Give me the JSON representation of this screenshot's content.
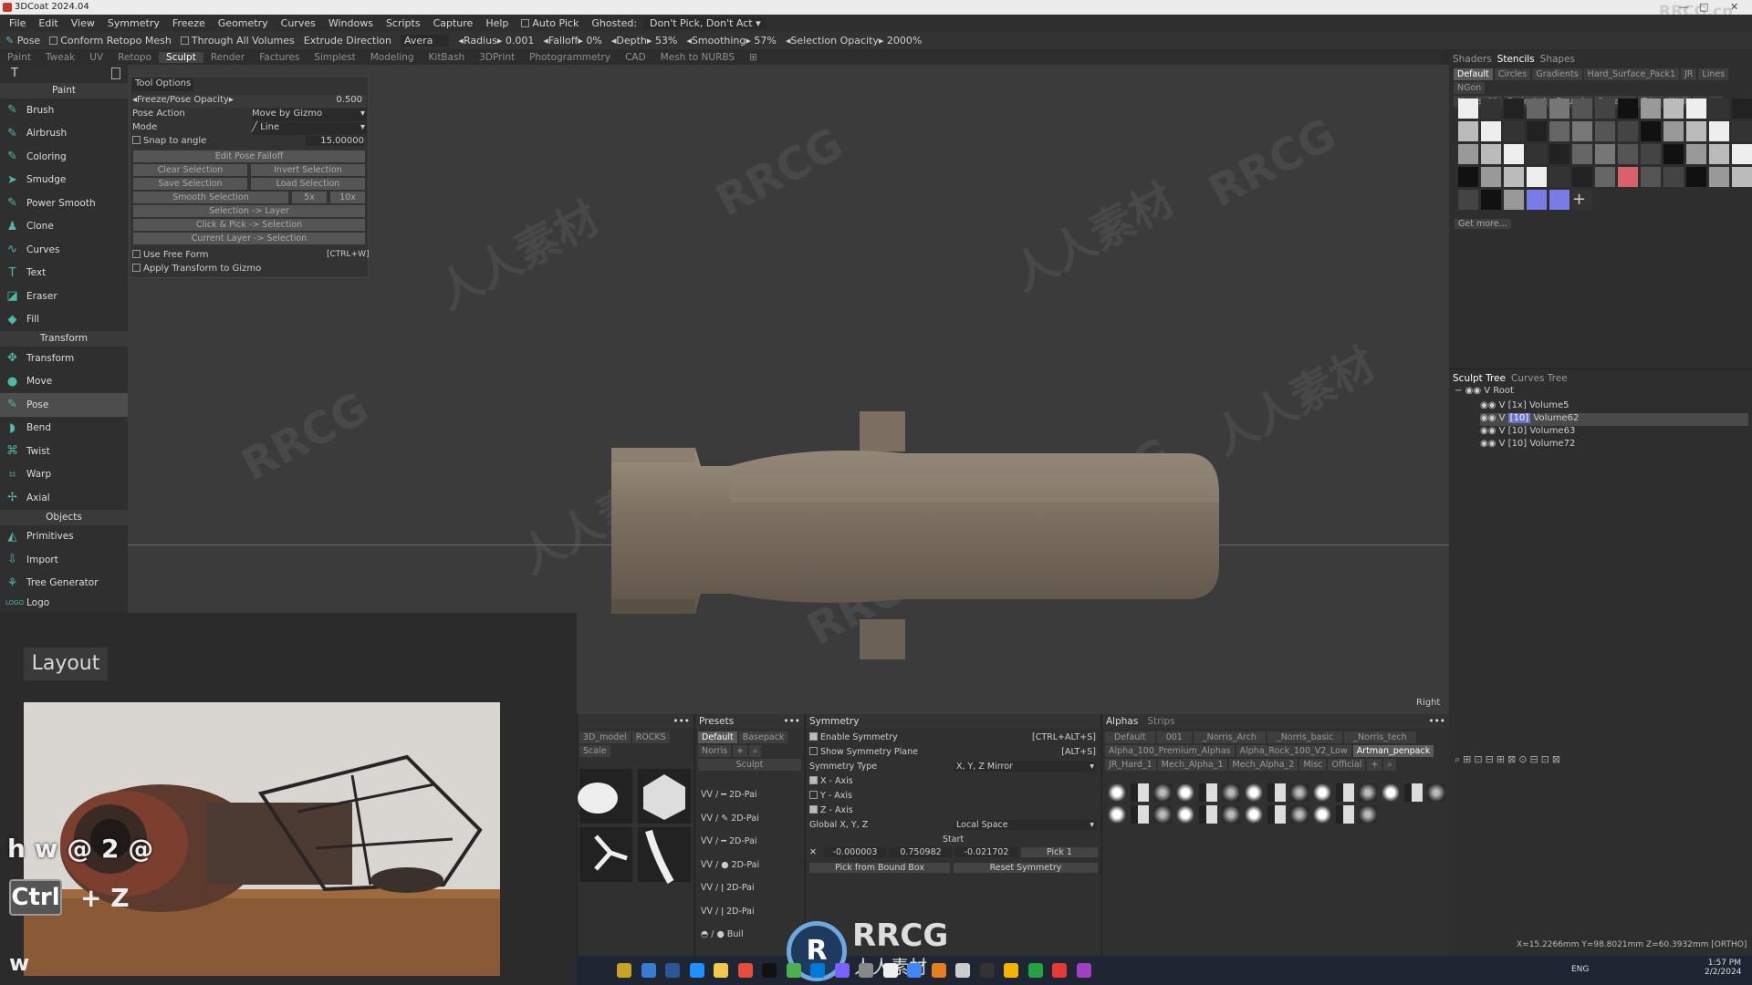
{
  "window": {
    "title": "3DCoat 2024.04",
    "watermark": "RRCG.cn"
  },
  "menu": [
    "File",
    "Edit",
    "View",
    "Symmetry",
    "Freeze",
    "Geometry",
    "Curves",
    "Windows",
    "Scripts",
    "Capture",
    "Help"
  ],
  "menu_extras": {
    "auto_pick": "Auto Pick",
    "ghosted_label": "Ghosted:",
    "ghosted_value": "Don't Pick, Don't Act"
  },
  "toolbar": {
    "mode": "Pose",
    "conform": "Conform Retopo Mesh",
    "through": "Through All Volumes",
    "extrude": "Extrude Direction",
    "extrude_value": "Avera",
    "radius_label": "Radius",
    "radius_value": "0.001",
    "falloff_label": "Falloff",
    "falloff_value": "0%",
    "depth_label": "Depth",
    "depth_value": "53%",
    "smoothing_label": "Smoothing",
    "smoothing_value": "57%",
    "selopacity_label": "Selection Opacity",
    "selopacity_value": "2000%"
  },
  "rooms": [
    "Paint",
    "Tweak",
    "UV",
    "Retopo",
    "Sculpt",
    "Render",
    "Factures",
    "Simplest",
    "Modeling",
    "KitBash",
    "3DPrint",
    "Photogrammetry",
    "CAD",
    "Mesh to NURBS"
  ],
  "active_room": "Sculpt",
  "left": {
    "paint_header": "Paint",
    "paint_tools": [
      "Brush",
      "Airbrush",
      "Coloring",
      "Smudge",
      "Power Smooth",
      "Clone",
      "Curves",
      "Text",
      "Eraser",
      "Fill"
    ],
    "transform_header": "Transform",
    "transform_tools": [
      "Transform",
      "Move",
      "Pose",
      "Bend",
      "Twist",
      "Warp",
      "Axial"
    ],
    "objects_header": "Objects",
    "object_tools": [
      "Primitives",
      "Import",
      "Tree Generator",
      "Logo"
    ],
    "active_tool": "Pose"
  },
  "tool_options": {
    "title": "Tool Options",
    "freeze_label": "Freeze/Pose Opacity",
    "freeze_value": "0.500",
    "pose_action_label": "Pose Action",
    "pose_action_value": "Move by Gizmo",
    "mode_label": "Mode",
    "mode_value": "Line",
    "snap_label": "Snap to angle",
    "snap_value": "15.00000",
    "edit_falloff": "Edit Pose Falloff",
    "clear_sel": "Clear Selection",
    "invert_sel": "Invert Selection",
    "save_sel": "Save Selection",
    "load_sel": "Load Selection",
    "smooth_sel": "Smooth Selection",
    "x5": "5x",
    "x10": "10x",
    "sel_layer": "Selection -> Layer",
    "click_pick": "Click & Pick -> Selection",
    "cur_layer": "Current Layer -> Selection",
    "free_form": "Use Free Form",
    "free_form_key": "[CTRL+W]",
    "apply_gizmo": "Apply Transform to Gizmo"
  },
  "viewport": {
    "view_label": "Right",
    "watermarks": [
      "RRCG",
      "人人素材"
    ]
  },
  "right": {
    "tabs": [
      "Shaders",
      "Stencils",
      "Shapes"
    ],
    "active_tab": "Stencils",
    "stencil_filters_1": [
      "Default",
      "Circles",
      "Gradients",
      "Hard_Surface_Pack1",
      "JR",
      "Lines",
      "NGon"
    ],
    "stencil_filters_2": [
      "Norris_01",
      "Project_A",
      "Rounds",
      "Squares",
      "Trim",
      "Wall"
    ],
    "get_more": "Get more...",
    "tree_tabs": [
      "Sculpt Tree",
      "Curves Tree"
    ],
    "tree_root": "Root",
    "tree_items": [
      {
        "tag": "[1x]",
        "name": "Volume5"
      },
      {
        "tag": "[10]",
        "name": "Volume62"
      },
      {
        "tag": "[10]",
        "name": "Volume63"
      },
      {
        "tag": "[10]",
        "name": "Volume72"
      }
    ],
    "status": "X=15.2266mm  Y=98.8021mm  Z=60.3932mm [ORTHO]"
  },
  "layout": {
    "title": "Layout",
    "keys_1": "h w @ 2 @",
    "keys_ctrl": "Ctrl",
    "keys_plus": "+ Z",
    "keys_w": "w"
  },
  "brush_panel": {
    "tabs": [
      "3D_model",
      "ROCKS",
      "Scale"
    ]
  },
  "presets": {
    "title": "Presets",
    "filters": [
      "Default",
      "Basepack"
    ],
    "search": "Norris",
    "section": "Sculpt",
    "items": [
      "2D-Pai",
      "2D-Pai",
      "2D-Pai",
      "2D-Pai",
      "2D-Pai",
      "2D-Pai",
      "Buil"
    ]
  },
  "symmetry": {
    "title": "Symmetry",
    "enable": "Enable Symmetry",
    "enable_key": "[CTRL+ALT+S]",
    "show_plane": "Show Symmetry Plane",
    "show_key": "[ALT+S]",
    "type_label": "Symmetry Type",
    "type_value": "X, Y, Z Mirror",
    "x_axis": "X - Axis",
    "y_axis": "Y - Axis",
    "z_axis": "Z - Axis",
    "global_label": "Global X, Y, Z",
    "global_value": "Local Space",
    "start_label": "Start",
    "sx": "-0.000003",
    "sy": "0.750982",
    "sz": "-0.021702",
    "pick": "Pick 1",
    "pick_bound": "Pick from Bound Box",
    "reset": "Reset Symmetry"
  },
  "alphas": {
    "tabs": [
      "Alphas",
      "Strips"
    ],
    "row1": [
      "Default",
      "001",
      "_Norris_Arch",
      "_Norris_basic",
      "_Norris_tech"
    ],
    "row2": [
      "Alpha_100_Premium_Alphas",
      "Alpha_Rock_100_V2_Low",
      "Artman_penpack"
    ],
    "row3": [
      "JR_Hard_1",
      "Mech_Alpha_1",
      "Mech_Alpha_2",
      "Misc",
      "Official"
    ]
  },
  "taskbar": {
    "lang": "ENG",
    "time": "1:57 PM",
    "date": "2/2/2024",
    "logo_text": "RRCG",
    "logo_sub": "人人素材"
  }
}
